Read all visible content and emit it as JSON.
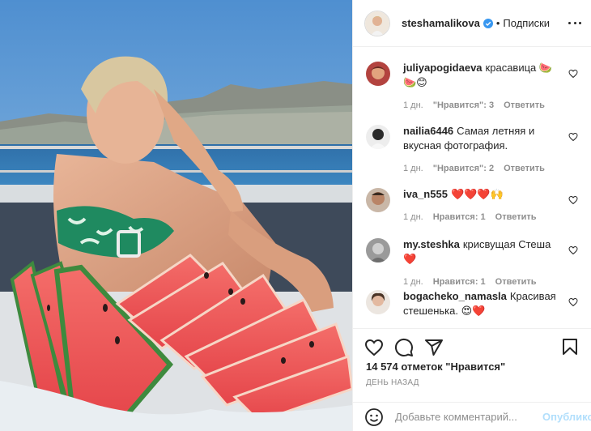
{
  "post": {
    "author": "steshamalikova",
    "follow_sep": "•",
    "follow_label": "Подписки",
    "likes": "14 574 отметок \"Нравится\"",
    "time": "День назад"
  },
  "comments": [
    {
      "user": "juliyapogidaeva",
      "text": "красавица 🍉🍉😊",
      "age": "1 дн.",
      "likes": "\"Нравится\": 3",
      "reply": "Ответить"
    },
    {
      "user": "nailia6446",
      "text": "Самая летняя и вкусная фотография.",
      "age": "1 дн.",
      "likes": "\"Нравится\": 2",
      "reply": "Ответить"
    },
    {
      "user": "iva_n555",
      "text": "❤️❤️❤️🙌",
      "age": "1 дн.",
      "likes": "Нравится: 1",
      "reply": "Ответить"
    },
    {
      "user": "my.steshka",
      "text": "крисвущая Стеша❤️",
      "age": "1 дн.",
      "likes": "Нравится: 1",
      "reply": "Ответить"
    },
    {
      "user": "bogacheko_namasla",
      "text": "Красивая стешенька. 😍❤️",
      "age": "",
      "likes": "",
      "reply": ""
    }
  ],
  "add_comment": {
    "placeholder": "Добавьте комментарий...",
    "publish": "Опубликовать"
  },
  "icons": {
    "like": "heart-icon",
    "comment": "comment-icon",
    "share": "paper-plane-icon",
    "save": "bookmark-icon",
    "emoji": "smiley-icon",
    "more": "more-icon",
    "verified": "verified-badge-icon"
  },
  "colors": {
    "verified": "#3897f0",
    "publish_disabled": "#b2dffc",
    "muted": "#8e8e8e"
  }
}
